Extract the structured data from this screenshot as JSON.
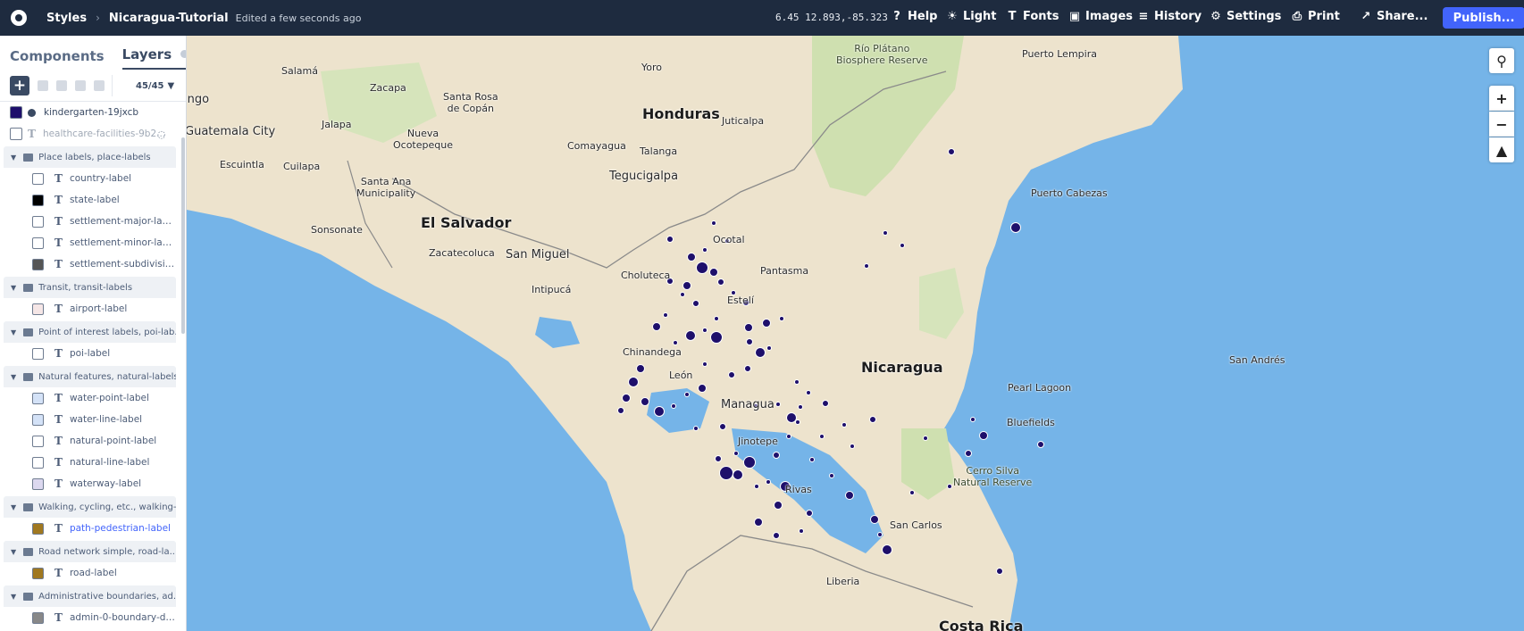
{
  "topbar": {
    "styles_label": "Styles",
    "style_name": "Nicaragua-Tutorial",
    "edited": "Edited a few seconds ago",
    "coords": "6.45 12.893,-85.323",
    "help": "Help",
    "light": "Light",
    "fonts": "Fonts",
    "images": "Images",
    "history": "History",
    "settings": "Settings",
    "print": "Print",
    "share": "Share...",
    "publish": "Publish..."
  },
  "sidebar": {
    "tab_components": "Components",
    "tab_layers": "Layers",
    "layer_count": "45/45",
    "top_layers": [
      {
        "label": "kindergarten-19jxcb",
        "color": "#1e0f6b"
      },
      {
        "label": "healthcare-facilities-9b2...",
        "color": "#ffffff"
      }
    ],
    "groups": [
      {
        "label": "Place labels, place-labels",
        "children": [
          {
            "label": "country-label",
            "color": "#ffffff"
          },
          {
            "label": "state-label",
            "color": "#000000"
          },
          {
            "label": "settlement-major-label",
            "color": "#ffffff"
          },
          {
            "label": "settlement-minor-label",
            "color": "#ffffff"
          },
          {
            "label": "settlement-subdivision...",
            "color": "#555555"
          }
        ]
      },
      {
        "label": "Transit, transit-labels",
        "children": [
          {
            "label": "airport-label",
            "color": "#f5e6e6"
          }
        ]
      },
      {
        "label": "Point of interest labels, poi-lab...",
        "children": [
          {
            "label": "poi-label",
            "color": "#ffffff"
          }
        ]
      },
      {
        "label": "Natural features, natural-labels",
        "children": [
          {
            "label": "water-point-label",
            "color": "#d4e2f7"
          },
          {
            "label": "water-line-label",
            "color": "#d4e2f7"
          },
          {
            "label": "natural-point-label",
            "color": "#ffffff"
          },
          {
            "label": "natural-line-label",
            "color": "#ffffff"
          },
          {
            "label": "waterway-label",
            "color": "#dcd8ef"
          }
        ]
      },
      {
        "label": "Walking, cycling, etc., walking-...",
        "children": [
          {
            "label": "path-pedestrian-label",
            "color": "#a07820"
          }
        ]
      },
      {
        "label": "Road network simple, road-la...",
        "children": [
          {
            "label": "road-label",
            "color": "#a07820"
          }
        ]
      },
      {
        "label": "Administrative boundaries, ad...",
        "children": [
          {
            "label": "admin-0-boundary-disp...",
            "color": "#888888"
          }
        ]
      }
    ]
  },
  "map": {
    "labels": {
      "honduras": "Honduras",
      "nicaragua": "Nicaragua",
      "el_salvador": "El Salvador",
      "costa_rica": "Costa Rica",
      "guatemala_city": "Guatemala City",
      "tegucigalpa": "Tegucigalpa",
      "managua": "Managua",
      "puerto_cabezas": "Puerto Cabezas",
      "bluefields": "Bluefields",
      "san_andres": "San Andrés",
      "rio_platano": "Río Plátano\nBiosphere Reserve",
      "cerro_silva": "Cerro Silva\nNatural Reserve",
      "puerto_lempira": "Puerto Lempira",
      "salama": "Salamá",
      "zacapa": "Zacapa",
      "yoro": "Yoro",
      "santa_rosa": "Santa Rosa\nde Copán",
      "juticalpa": "Juticalpa",
      "jalapa": "Jalapa",
      "nueva_ocotepeque": "Nueva\nOcotepeque",
      "comayagua": "Comayagua",
      "talanga": "Talanga",
      "escuintla": "Escuintla",
      "cuilapa": "Cuilapa",
      "santa_ana": "Santa Ana\nMunicipality",
      "sonsonate": "Sonsonate",
      "zacatecoluca": "Zacatecoluca",
      "san_miguel": "San Miguel",
      "intipuca": "Intipucá",
      "choluteca": "Choluteca",
      "ocotal": "Ocotal",
      "pantasma": "Pantasma",
      "esteli": "Estelí",
      "chinandega": "Chinandega",
      "leon": "León",
      "jinotepe": "Jinotepe",
      "rivas": "Rivas",
      "san_carlos": "San Carlos",
      "pearl_lagoon": "Pearl Lagoon",
      "liberia": "Liberia",
      "ingo": "ingo"
    },
    "colors": {
      "water": "#75b4e8",
      "land": "#ede3cd",
      "forest": "#cfe0b0",
      "points": "#1e0f6b",
      "accent": "#4264fb"
    }
  }
}
